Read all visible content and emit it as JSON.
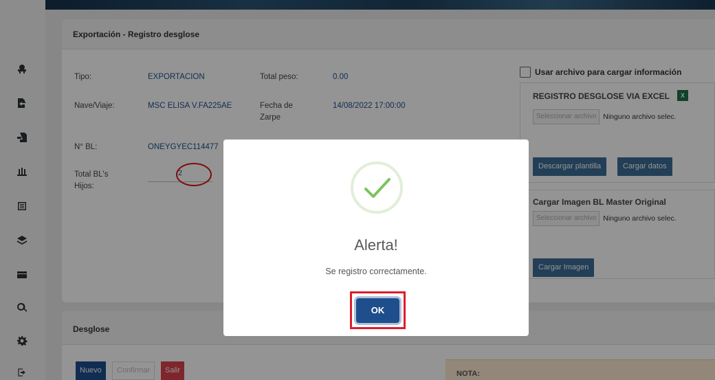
{
  "top_card": {
    "title": "Exportación - Registro desglose"
  },
  "form": {
    "tipo_label": "Tipo:",
    "tipo_value": "EXPORTACION",
    "total_peso_label": "Total peso:",
    "total_peso_value": "0.00",
    "nave_label": "Nave/Viaje:",
    "nave_value": "MSC ELISA V.FA225AE",
    "fecha_zarpe_label_1": "Fecha de",
    "fecha_zarpe_label_2": "Zarpe",
    "fecha_zarpe_value": "14/08/2022 17:00:00",
    "nbl_label": "N° BL:",
    "nbl_value": "ONEYGYEC114477",
    "total_bls_label_1": "Total BL's",
    "total_bls_label_2": "Hijos:",
    "total_bls_value": "2"
  },
  "right_panel": {
    "checkbox_label": "Usar archivo para cargar información",
    "excel_title": "REGISTRO DESGLOSE VIA EXCEL",
    "excel_file_button": "Seleccionar archivo",
    "excel_file_text": "Ninguno archivo selec.",
    "download_template": "Descargar plantilla",
    "load_data": "Cargar datos",
    "image_title": "Cargar Imagen BL Master Original",
    "image_file_button": "Seleccionar archivo",
    "image_file_text": "Ninguno archivo selec.",
    "load_image": "Cargar Imagen"
  },
  "desglose": {
    "title": "Desglose",
    "nuevo": "Nuevo",
    "confirmar": "Confirmar",
    "salir": "Salir",
    "nota": "NOTA:"
  },
  "sidebar_icons": [
    "ship-icon",
    "export-icon",
    "import-icon",
    "container-icon",
    "list-icon",
    "layers-icon",
    "card-icon",
    "search-icon",
    "gear-icon",
    "logout-icon"
  ],
  "modal": {
    "title": "Alerta!",
    "message": "Se registro correctamente.",
    "ok": "OK"
  },
  "colors": {
    "primary": "#1e4f8c",
    "button_blue": "#3c6d96",
    "danger": "#d9424b",
    "success": "#7cc35f",
    "highlight_red": "#dd1d2a"
  }
}
